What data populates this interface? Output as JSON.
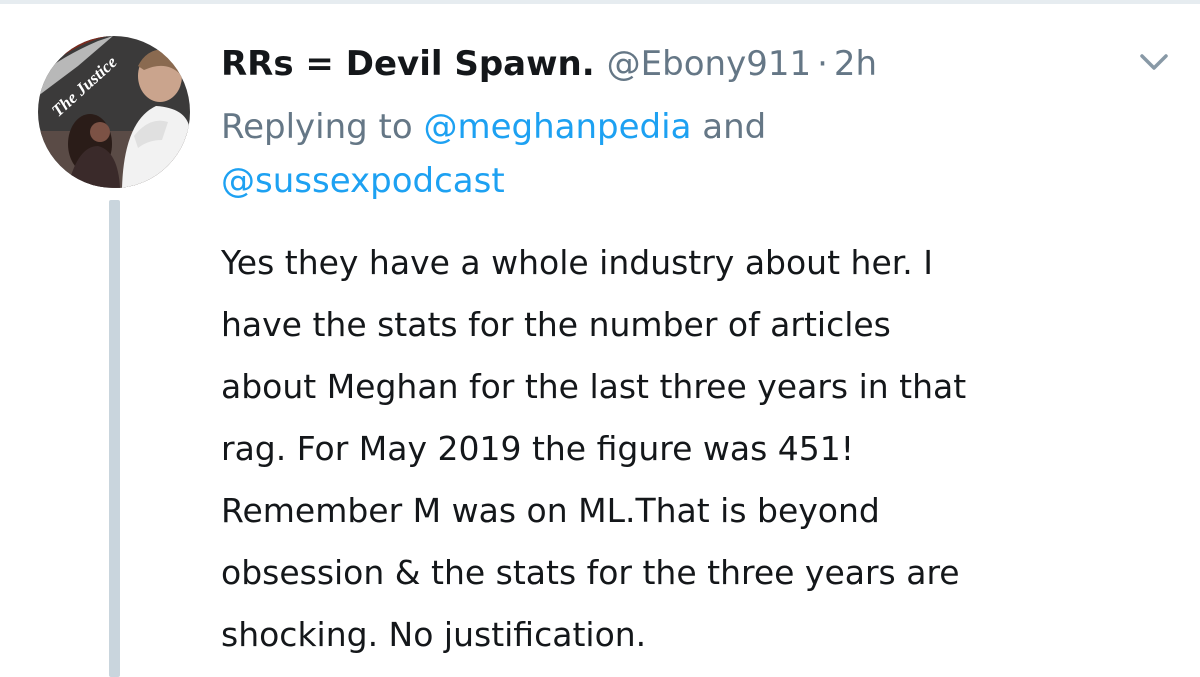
{
  "tweet": {
    "author_name": "RRs = Devil Spawn.",
    "author_handle": "@Ebony911",
    "separator": "·",
    "time": "2h",
    "reply": {
      "prefix": "Replying to",
      "mention_1": "@meghanpedia",
      "joiner": "and",
      "mention_2": "@sussexpodcast"
    },
    "text_lines": [
      "Yes they have a whole industry about her. I",
      "have the stats for the number of articles",
      "about Meghan for the last three years in that",
      "rag. For May 2019 the figure was 451!",
      "Remember M was on ML.That is beyond",
      "obsession & the stats for the three years are",
      "shocking. No justification."
    ],
    "avatar_overlay_text": "The Justice"
  },
  "icons": {
    "caret": "chevron-down-icon"
  },
  "colors": {
    "primary_text": "#14171a",
    "secondary_text": "#657786",
    "mention": "#1da1f2",
    "thread_line": "#c9d5dd",
    "divider": "#e6ecf0"
  }
}
